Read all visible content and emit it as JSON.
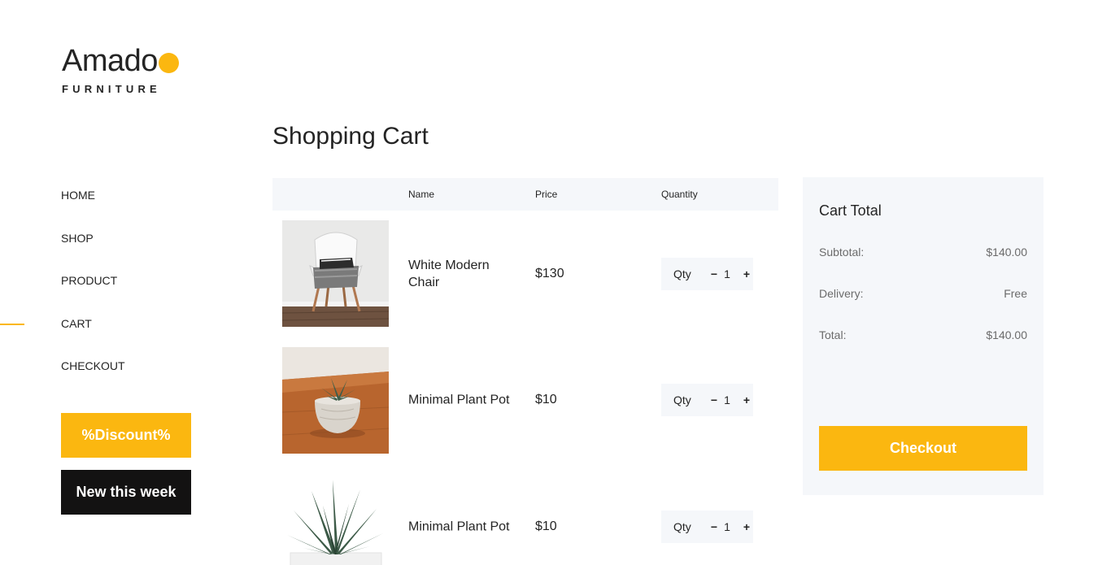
{
  "brand": {
    "name": "Amado",
    "tagline": "FURNITURE",
    "accent": "#fbb710",
    "dark": "#131212",
    "panel": "#f5f7fa"
  },
  "nav": {
    "items": [
      "HOME",
      "SHOP",
      "PRODUCT",
      "CART",
      "CHECKOUT"
    ],
    "active": "CART"
  },
  "promos": {
    "discount": "%Discount%",
    "new_week": "New this week"
  },
  "page": {
    "title": "Shopping Cart"
  },
  "cart": {
    "headers": {
      "name": "Name",
      "price": "Price",
      "quantity": "Quantity"
    },
    "qty_label": "Qty",
    "minus": "−",
    "plus": "+",
    "items": [
      {
        "name": "White Modern Chair",
        "price": "$130",
        "qty": "1",
        "image": "white-chair-photo"
      },
      {
        "name": "Minimal Plant Pot",
        "price": "$10",
        "qty": "1",
        "image": "succulent-pot-photo"
      },
      {
        "name": "Minimal Plant Pot",
        "price": "$10",
        "qty": "1",
        "image": "aloe-plant-photo"
      }
    ]
  },
  "summary": {
    "title": "Cart Total",
    "subtotal_label": "Subtotal:",
    "subtotal": "$140.00",
    "delivery_label": "Delivery:",
    "delivery": "Free",
    "total_label": "Total:",
    "total": "$140.00",
    "checkout": "Checkout"
  }
}
